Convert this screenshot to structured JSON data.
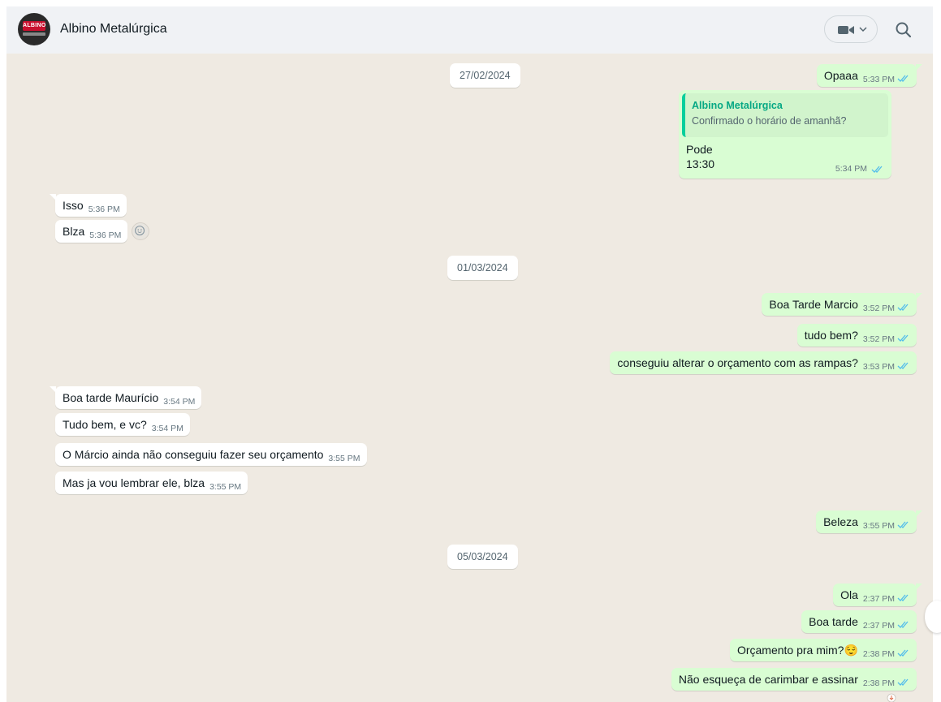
{
  "header": {
    "contact_name": "Albino Metalúrgica",
    "avatar_text": "ALBINO"
  },
  "dates": [
    "27/02/2024",
    "01/03/2024",
    "05/03/2024"
  ],
  "messages": [
    {
      "dir": "out",
      "text": "Opaaa",
      "time": "5:33 PM"
    },
    {
      "dir": "out",
      "quote_author": "Albino Metalúrgica",
      "quote_text": "Confirmado o horário de amanhã?",
      "text_line1": "Pode",
      "text_line2": "13:30",
      "time": "5:34 PM"
    },
    {
      "dir": "in",
      "text": "Isso",
      "time": "5:36 PM"
    },
    {
      "dir": "in",
      "text": "Blza",
      "time": "5:36 PM"
    },
    {
      "dir": "out",
      "text": "Boa Tarde Marcio",
      "time": "3:52 PM"
    },
    {
      "dir": "out",
      "text": "tudo bem?",
      "time": "3:52 PM"
    },
    {
      "dir": "out",
      "text": "conseguiu alterar o orçamento com as rampas?",
      "time": "3:53 PM"
    },
    {
      "dir": "in",
      "text": "Boa tarde Maurício",
      "time": "3:54 PM"
    },
    {
      "dir": "in",
      "text": "Tudo bem, e vc?",
      "time": "3:54 PM"
    },
    {
      "dir": "in",
      "text": "O Márcio ainda não conseguiu fazer seu orçamento",
      "time": "3:55 PM"
    },
    {
      "dir": "in",
      "text": "Mas ja vou lembrar ele, blza",
      "time": "3:55 PM"
    },
    {
      "dir": "out",
      "text": "Beleza",
      "time": "3:55 PM"
    },
    {
      "dir": "out",
      "text": "Ola",
      "time": "2:37 PM"
    },
    {
      "dir": "out",
      "text": "Boa tarde",
      "time": "2:37 PM"
    },
    {
      "dir": "out",
      "text": "Orçamento pra mim?😌",
      "time": "2:38 PM"
    },
    {
      "dir": "out",
      "text": "Não esqueça de carimbar e assinar",
      "time": "2:38 PM"
    }
  ],
  "colors": {
    "header_bg": "#f0f2f5",
    "chat_bg": "#efeae2",
    "incoming": "#ffffff",
    "outgoing": "#d9fdd3",
    "read_ticks": "#53bdeb",
    "quote_accent": "#06cf9c"
  },
  "icons": [
    "video-call-icon",
    "chevron-down-icon",
    "search-icon",
    "double-check-icon",
    "emoji-react-icon",
    "scroll-down-icon"
  ]
}
